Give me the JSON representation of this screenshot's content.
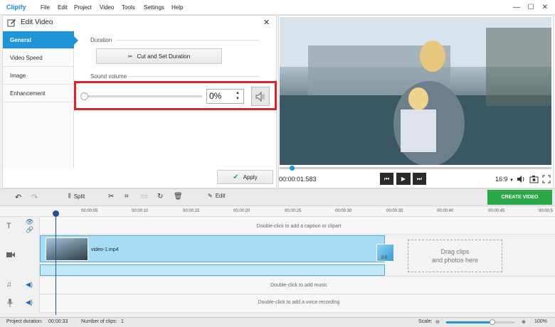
{
  "app": {
    "logo": "Clipify"
  },
  "menu": [
    "File",
    "Edit",
    "Project",
    "Video",
    "Tools",
    "Settings",
    "Help"
  ],
  "window_controls": {
    "minimize": "—",
    "maximize": "☐",
    "close": "✕"
  },
  "edit_panel": {
    "title": "Edit Video",
    "close": "✕",
    "nav": [
      "General",
      "Video Speed",
      "Image",
      "Enhancement"
    ],
    "duration_label": "Duration",
    "cut_button": "Cut and Set Duration",
    "sound_label": "Sound volume",
    "volume_value": "0%",
    "volume_level": 0,
    "apply_button": "Apply"
  },
  "preview": {
    "timecode": "00:00:01.583",
    "aspect": "16:9",
    "progress": 0.04
  },
  "toolbar": {
    "split": "Split",
    "edit": "Edit",
    "create": "CREATE VIDEO"
  },
  "timeline": {
    "ticks": [
      "00:00:05",
      "00:00:10",
      "00:00:15",
      "00:00:20",
      "00:00:25",
      "00:00:30",
      "00:00:35",
      "00:00:40",
      "00:00:45",
      "00:00:5"
    ],
    "caption_hint": "Double-click to add a caption or clipart",
    "clip_name": "video-1.mp4",
    "transition_label": "0.0",
    "dropzone": "Drag clips\nand photos here",
    "music_hint": "Double-click to add music",
    "voice_hint": "Double-click to add a voice recording"
  },
  "status": {
    "duration_label": "Project duration:",
    "duration_value": "00:00:33",
    "clips_label": "Number of clips:",
    "clips_value": "1",
    "scale_label": "Scale:",
    "zoom": "100%"
  },
  "colors": {
    "accent": "#1e95d4",
    "create": "#2ba84a",
    "highlight": "#d7262b",
    "clip": "#a6dcf6"
  }
}
